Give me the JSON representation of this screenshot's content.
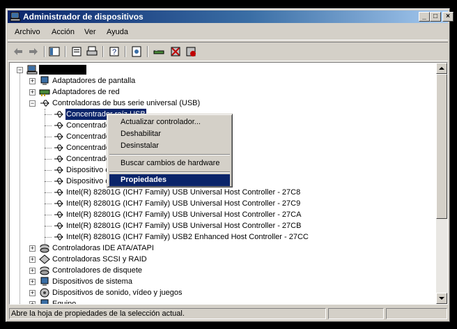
{
  "window": {
    "title": "Administrador de dispositivos"
  },
  "menubar": [
    "Archivo",
    "Acción",
    "Ver",
    "Ayuda"
  ],
  "tree": {
    "categories": {
      "display": "Adaptadores de pantalla",
      "network": "Adaptadores de red",
      "usb": "Controladoras de bus serie universal (USB)",
      "ide": "Controladoras IDE ATA/ATAPI",
      "scsi": "Controladoras SCSI y RAID",
      "floppy": "Controladores de disquete",
      "system": "Dispositivos de sistema",
      "sound": "Dispositivos de sonido, vídeo y juegos",
      "equipment": "Equipo"
    },
    "usb_children": [
      "Concentrador raíz USB",
      "Concentrado",
      "Concentrado",
      "Concentrado",
      "Concentrado",
      "Dispositivo co",
      "Dispositivo de",
      "Intel(R) 82801G (ICH7 Family) USB Universal Host Controller - 27C8",
      "Intel(R) 82801G (ICH7 Family) USB Universal Host Controller - 27C9",
      "Intel(R) 82801G (ICH7 Family) USB Universal Host Controller - 27CA",
      "Intel(R) 82801G (ICH7 Family) USB Universal Host Controller - 27CB",
      "Intel(R) 82801G (ICH7 Family) USB2 Enhanced Host Controller - 27CC"
    ]
  },
  "context_menu": {
    "update": "Actualizar controlador...",
    "disable": "Deshabilitar",
    "uninstall": "Desinstalar",
    "scan": "Buscar cambios de hardware",
    "properties": "Propiedades"
  },
  "statusbar": {
    "text": "Abre la hoja de propiedades de la selección actual."
  },
  "colors": {
    "titlebar": "#0a246a",
    "selection": "#0a246a",
    "face": "#d4d0c8"
  }
}
